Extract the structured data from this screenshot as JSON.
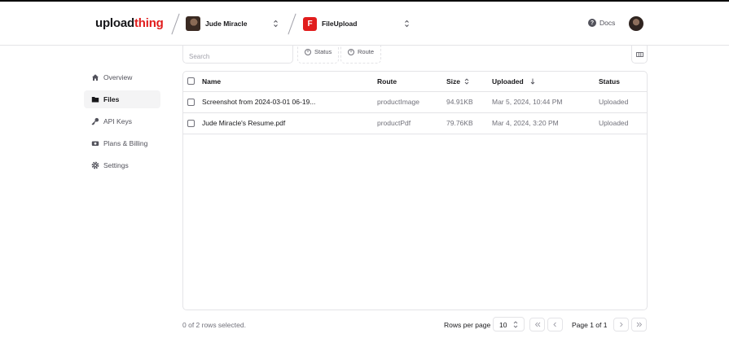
{
  "brand": {
    "logo_part1": "upload",
    "logo_part2": "thing",
    "accent": "#e11d1d"
  },
  "header": {
    "account_switcher": {
      "label": "Jude Miracle"
    },
    "app_switcher": {
      "badge": "F",
      "label": "FileUpload"
    },
    "docs_label": "Docs"
  },
  "sidebar": {
    "items": [
      {
        "label": "Overview",
        "icon": "home-icon"
      },
      {
        "label": "Files",
        "icon": "folder-icon",
        "active": true
      },
      {
        "label": "API Keys",
        "icon": "key-icon"
      },
      {
        "label": "Plans & Billing",
        "icon": "billing-icon"
      },
      {
        "label": "Settings",
        "icon": "gear-icon"
      }
    ]
  },
  "toolbar": {
    "search_placeholder": "Search",
    "filters": [
      "Status",
      "Route"
    ]
  },
  "table": {
    "columns": [
      "Name",
      "Route",
      "Size",
      "Uploaded",
      "Status"
    ],
    "rows": [
      {
        "name": "Screenshot from 2024-03-01 06-19...",
        "route": "productImage",
        "size": "94.91KB",
        "uploaded": "Mar 5, 2024, 10:44 PM",
        "status": "Uploaded"
      },
      {
        "name": "Jude Miracle's Resume.pdf",
        "route": "productPdf",
        "size": "79.76KB",
        "uploaded": "Mar 4, 2024, 3:20 PM",
        "status": "Uploaded"
      }
    ]
  },
  "footer": {
    "selected_text": "0 of 2 rows selected.",
    "rows_per_page_label": "Rows per page",
    "rows_per_page_value": "10",
    "page_info": "Page 1 of 1"
  }
}
